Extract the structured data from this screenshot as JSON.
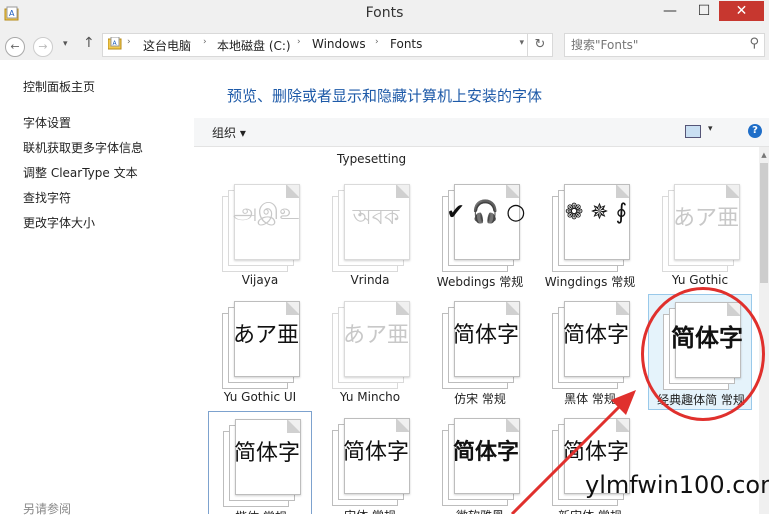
{
  "window": {
    "title": "Fonts",
    "minimize": "—",
    "maximize": "☐",
    "close": "✕"
  },
  "nav": {
    "back": "←",
    "forward": "→",
    "recent": "▾",
    "up": "↑",
    "breadcrumb": [
      "这台电脑",
      "本地磁盘 (C:)",
      "Windows",
      "Fonts"
    ],
    "separator": "›",
    "address_dropdown": "▾",
    "refresh": "↻",
    "search_placeholder": "搜索\"Fonts\"",
    "search_icon": "⚲"
  },
  "sidebar": {
    "home": "控制面板主页",
    "items": [
      "字体设置",
      "联机获取更多字体信息",
      "调整 ClearType 文本",
      "查找字符",
      "更改字体大小"
    ],
    "see_also": "另请参阅"
  },
  "main": {
    "heading": "预览、删除或者显示和隐藏计算机上安装的字体",
    "organize": "组织 ▾",
    "view_dropdown": "▾",
    "help": "?",
    "partial_label": "Typesetting",
    "fonts": [
      {
        "name": "Vijaya",
        "sample": "அஇஉ",
        "faded": true
      },
      {
        "name": "Vrinda",
        "sample": "অবক",
        "faded": true
      },
      {
        "name": "Webdings 常规",
        "sample": "✔ 🎧 ○",
        "faded": false
      },
      {
        "name": "Wingdings 常规",
        "sample": "❁ ✵ ∮",
        "faded": false
      },
      {
        "name": "Yu Gothic",
        "sample": "あア亜",
        "faded": true
      },
      {
        "name": "Yu Gothic UI",
        "sample": "あア亜",
        "faded": false
      },
      {
        "name": "Yu Mincho",
        "sample": "あア亜",
        "faded": true
      },
      {
        "name": "仿宋 常规",
        "sample": "简体字",
        "faded": false
      },
      {
        "name": "黑体 常规",
        "sample": "简体字",
        "faded": false
      },
      {
        "name": "经典趣体简 常规",
        "sample": "简体字",
        "faded": false
      },
      {
        "name": "楷体 常规",
        "sample": "简体字",
        "faded": false
      },
      {
        "name": "宋体 常规",
        "sample": "简体字",
        "faded": false
      },
      {
        "name": "微软雅黑",
        "sample": "简体字",
        "faded": false
      },
      {
        "name": "新宋体 常规",
        "sample": "简体字",
        "faded": false
      }
    ]
  },
  "watermark": "ylmfwin100.com",
  "colors": {
    "accent_text": "#1e5aa8",
    "annotation_red": "#e0302d",
    "selection_bg": "#e5f3fb"
  }
}
